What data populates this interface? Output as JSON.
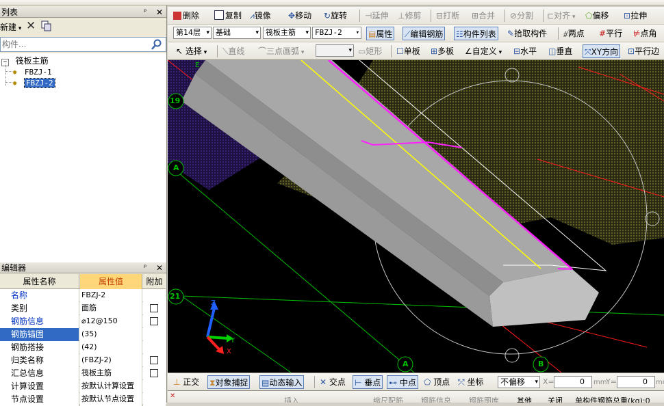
{
  "left_panel": {
    "list_title": "列表",
    "new_label": "新建",
    "search_placeholder": "构件...",
    "tree_root": "筏板主筋",
    "tree_items": [
      "FBZJ-1",
      "FBZJ-2"
    ],
    "editor_title": "编辑器",
    "pin": "ᵖ",
    "col_name": "属性名称",
    "col_value": "属性值",
    "col_extra": "附加",
    "rows": [
      {
        "name": "名称",
        "value": "FBZJ-2",
        "check": false,
        "blue": true
      },
      {
        "name": "类别",
        "value": "面筋",
        "check": true,
        "blue": false
      },
      {
        "name": "钢筋信息",
        "value": "⌀12@150",
        "check": true,
        "blue": true
      },
      {
        "name": "钢筋锚固",
        "value": "(35)",
        "check": false,
        "blue": false
      },
      {
        "name": "钢筋搭接",
        "value": "(42)",
        "check": false,
        "blue": false
      },
      {
        "name": "归类名称",
        "value": "(FBZJ-2)",
        "check": true,
        "blue": false
      },
      {
        "name": "汇总信息",
        "value": "筏板主筋",
        "check": true,
        "blue": false
      },
      {
        "name": "计算设置",
        "value": "按默认计算设置",
        "check": false,
        "blue": false
      },
      {
        "name": "节点设置",
        "value": "按默认节点设置",
        "check": false,
        "blue": false
      }
    ]
  },
  "toolbar1": {
    "delete": "删除",
    "copy": "复制",
    "mirror": "镜像",
    "move": "移动",
    "rotate": "旋转",
    "extend": "延伸",
    "trim": "修剪",
    "break": "打断",
    "merge": "合并",
    "split": "分割",
    "align": "对齐",
    "offset": "偏移",
    "stretch": "拉伸"
  },
  "toolbar2": {
    "floor": "第14层",
    "category": "基础",
    "type": "筏板主筋",
    "component": "FBZJ-2",
    "properties": "属性",
    "edit_rebar": "编辑钢筋",
    "comp_list": "构件列表",
    "pick": "拾取构件",
    "two_points": "两点",
    "parallel": "平行",
    "point_angle": "点角"
  },
  "toolbar3": {
    "select": "选择",
    "line": "直线",
    "arc": "三点画弧",
    "rect": "矩形",
    "single": "单板",
    "multi": "多板",
    "custom": "自定义",
    "horizontal": "水平",
    "vertical": "垂直",
    "xy_dir": "XY方向",
    "parallel_edge": "平行边"
  },
  "canvas": {
    "axis_labels": [
      "19",
      "A",
      "21",
      "A",
      "B",
      "E"
    ]
  },
  "statusbar": {
    "ortho": "正交",
    "snap": "对象捕捉",
    "dyn_input": "动态输入",
    "intersect": "交点",
    "perp": "垂点",
    "mid": "中点",
    "vertex": "顶点",
    "coord": "坐标",
    "no_offset": "不偏移",
    "x_label": "X=",
    "x_val": "0",
    "y_label": "Y=",
    "y_val": "0",
    "unit": "mm"
  },
  "bottom_strip": {
    "insert": "插入",
    "fill": "缩尺配筋",
    "rebar_info": "钢筋信息",
    "rebar_lib": "钢筋图库",
    "other": "其他",
    "close": "关闭",
    "total": "单构件钢筋总重(kg):0"
  }
}
